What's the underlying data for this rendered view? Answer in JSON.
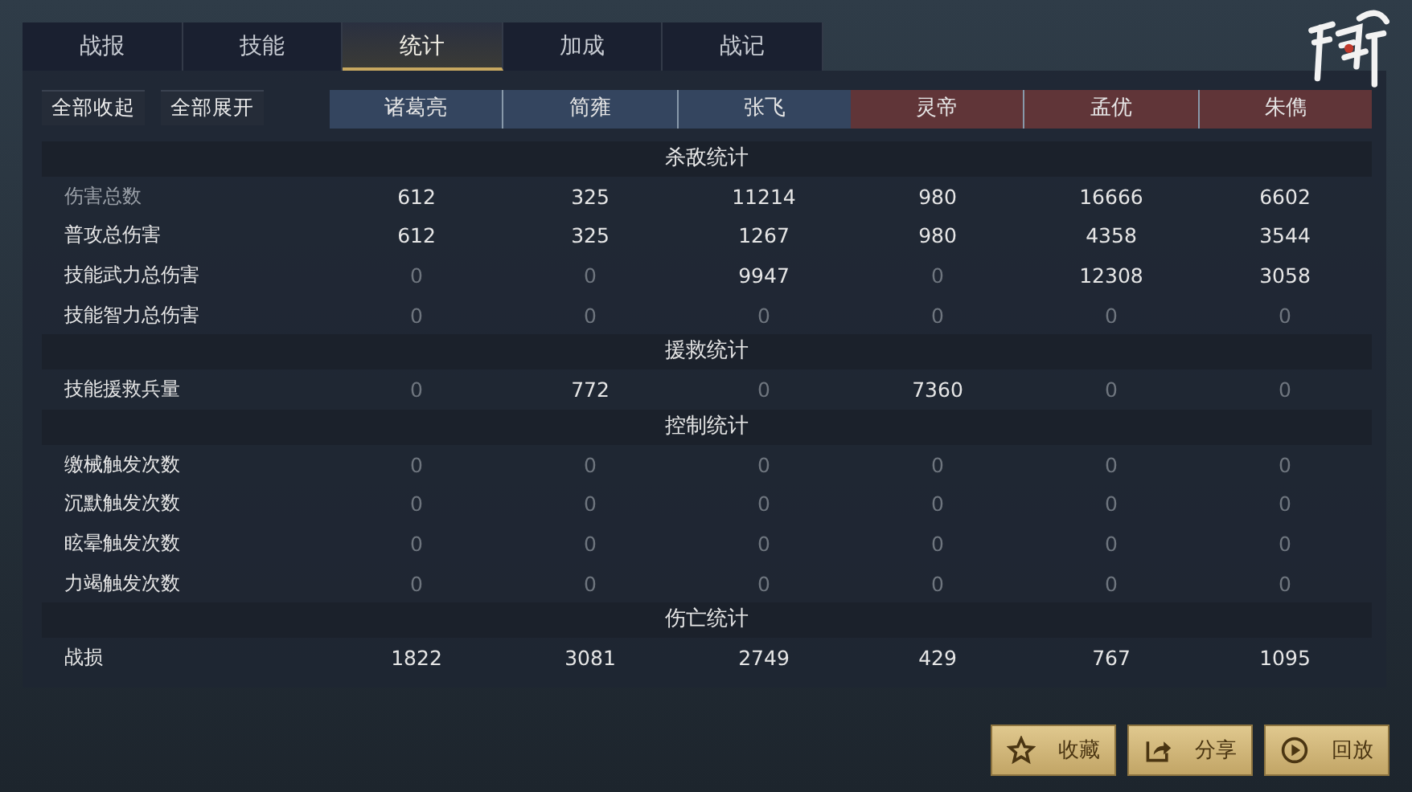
{
  "tabs": [
    {
      "label": "战报",
      "selected": false
    },
    {
      "label": "技能",
      "selected": false
    },
    {
      "label": "统计",
      "selected": true
    },
    {
      "label": "加成",
      "selected": false
    },
    {
      "label": "战记",
      "selected": false
    }
  ],
  "toggle_buttons": [
    "全部收起",
    "全部展开"
  ],
  "teams": [
    {
      "color": "#34455f",
      "heroes": [
        "诸葛亮",
        "简雍",
        "张飞"
      ]
    },
    {
      "color": "#603538",
      "heroes": [
        "灵帝",
        "孟优",
        "朱儁"
      ]
    }
  ],
  "sections": [
    {
      "title": "杀敌统计",
      "rows": [
        {
          "label": "伤害总数",
          "muted": true,
          "values": [
            "612",
            "325",
            "11214",
            "980",
            "16666",
            "6602"
          ]
        },
        {
          "label": "普攻总伤害",
          "muted": false,
          "values": [
            "612",
            "325",
            "1267",
            "980",
            "4358",
            "3544"
          ]
        },
        {
          "label": "技能武力总伤害",
          "muted": false,
          "values": [
            "0",
            "0",
            "9947",
            "0",
            "12308",
            "3058"
          ]
        },
        {
          "label": "技能智力总伤害",
          "muted": false,
          "values": [
            "0",
            "0",
            "0",
            "0",
            "0",
            "0"
          ]
        }
      ]
    },
    {
      "title": "援救统计",
      "rows": [
        {
          "label": "技能援救兵量",
          "muted": false,
          "values": [
            "0",
            "772",
            "0",
            "7360",
            "0",
            "0"
          ]
        }
      ]
    },
    {
      "title": "控制统计",
      "rows": [
        {
          "label": "缴械触发次数",
          "muted": false,
          "values": [
            "0",
            "0",
            "0",
            "0",
            "0",
            "0"
          ]
        },
        {
          "label": "沉默触发次数",
          "muted": false,
          "values": [
            "0",
            "0",
            "0",
            "0",
            "0",
            "0"
          ]
        },
        {
          "label": "眩晕触发次数",
          "muted": false,
          "values": [
            "0",
            "0",
            "0",
            "0",
            "0",
            "0"
          ]
        },
        {
          "label": "力竭触发次数",
          "muted": false,
          "values": [
            "0",
            "0",
            "0",
            "0",
            "0",
            "0"
          ]
        }
      ]
    },
    {
      "title": "伤亡统计",
      "rows": [
        {
          "label": "战损",
          "muted": false,
          "values": [
            "1822",
            "3081",
            "2749",
            "429",
            "767",
            "1095"
          ]
        }
      ]
    }
  ],
  "actions": [
    {
      "kind": "star",
      "label": "收藏"
    },
    {
      "kind": "share",
      "label": "分享"
    },
    {
      "kind": "play",
      "label": "回放"
    }
  ]
}
